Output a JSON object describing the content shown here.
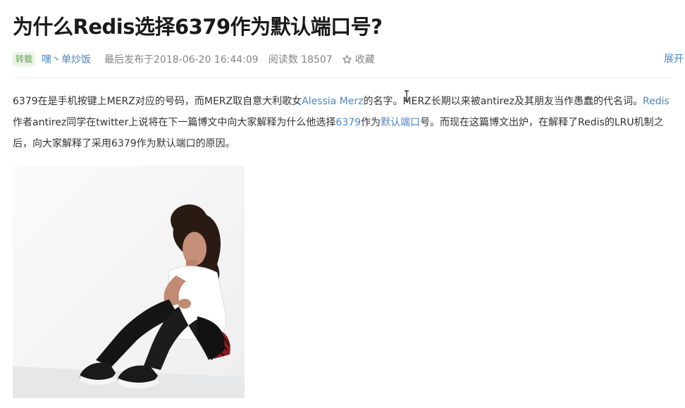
{
  "article": {
    "title": "为什么Redis选择6379作为默认端口号?",
    "meta": {
      "tag": "转载",
      "author": "嘿丶单炒饭",
      "date": "最后发布于2018-06-20 16:44:09",
      "reads": "阅读数 18507",
      "favorite": "收藏",
      "expand": "展开"
    },
    "paragraph": {
      "s1": "6379在是手机按键上MERZ对应的号码，而MERZ取自意大利歌女",
      "link_singer": "Alessia Merz",
      "s2": "的名字。MERZ长期以来被antirez及其朋友当作愚蠢的代名词。",
      "link_redis": "Redis",
      "s3": "作者antirez同学在twitter上说将在下一篇博文中向大家解释为什么他选择",
      "link_port": "6379",
      "s4": "作为",
      "link_default": "默认端口",
      "s5": "号。而现在这篇博文出炉，在解释了Redis的LRU机制之后，向大家解释了采用6379作为默认端口的原因。"
    }
  },
  "icons": {
    "favorite": "star-outline-icon",
    "cursor": "text-cursor-icon"
  },
  "colors": {
    "link": "#4a86c5",
    "tag_bg": "#eaf4e6",
    "tag_text": "#5aa346",
    "meta_text": "#858585",
    "title": "#1a1a1a"
  }
}
